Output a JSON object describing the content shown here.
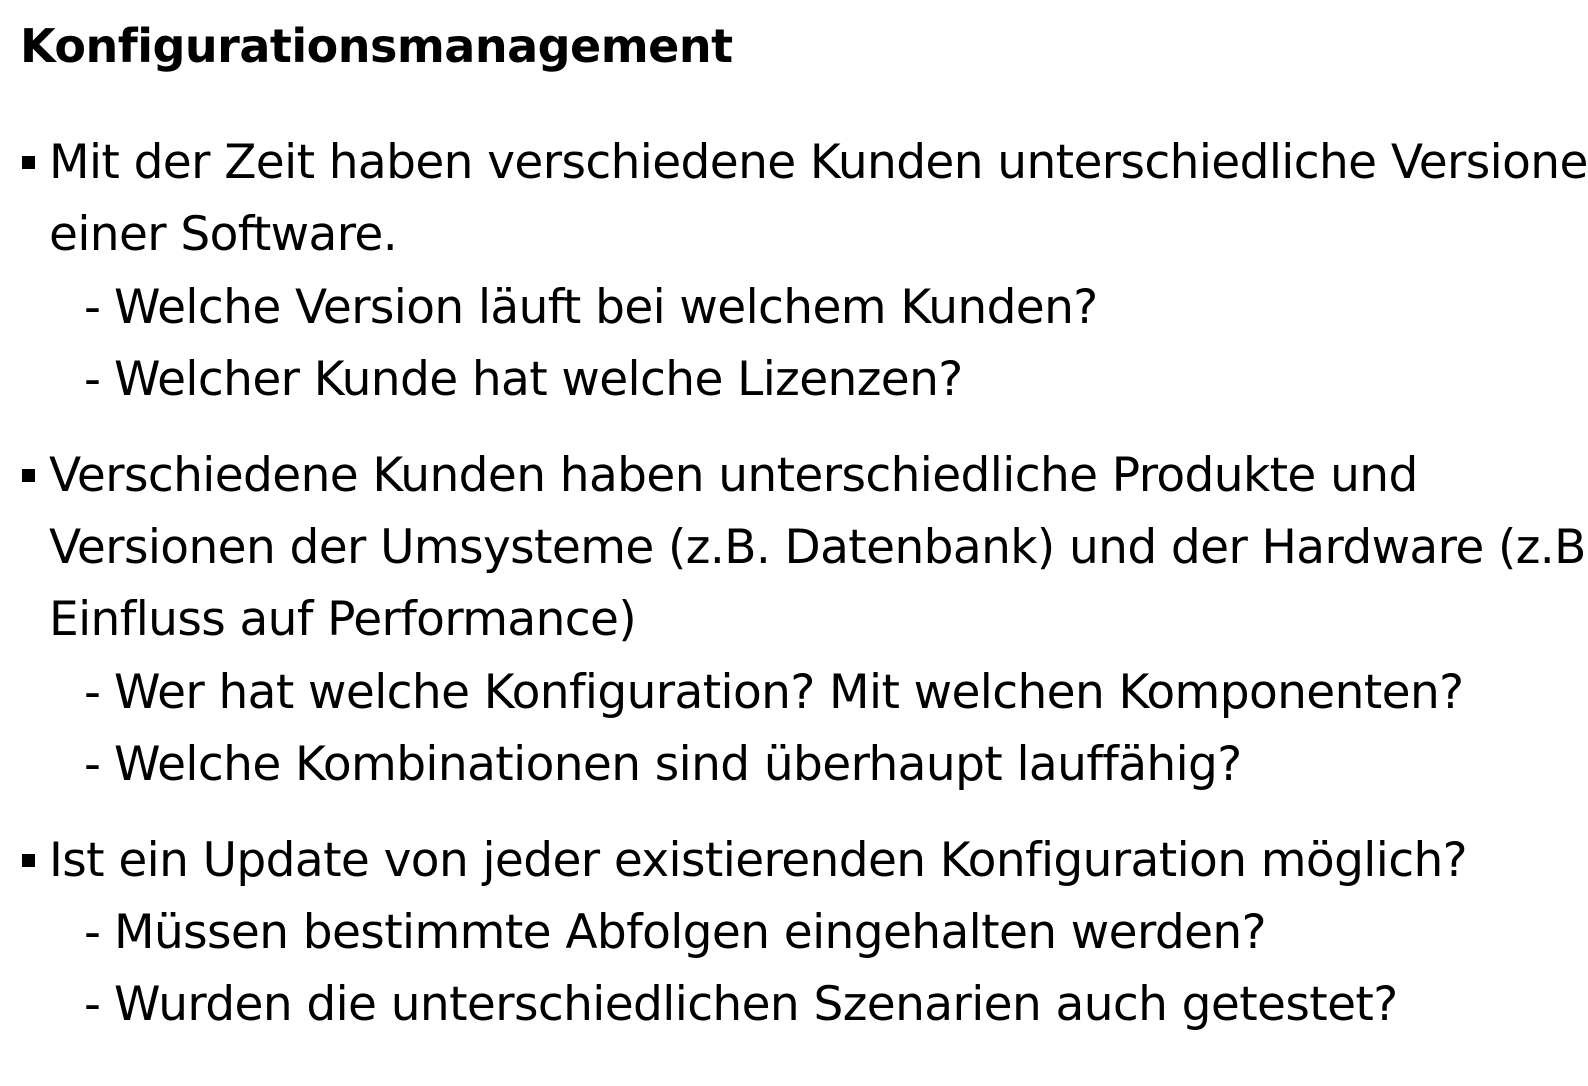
{
  "title": "Konfigurationsmanagement",
  "sections": [
    {
      "lines": [
        "Mit der Zeit haben verschiedene Kunden unterschiedliche Versionen",
        "einer Software."
      ],
      "subitems": [
        "Welche Version läuft bei welchem Kunden?",
        "Welcher Kunde hat welche Lizenzen?"
      ]
    },
    {
      "lines": [
        "Verschiedene Kunden haben unterschiedliche Produkte und",
        "Versionen der Umsysteme (z.B. Datenbank) und der Hardware (z.B.",
        "Einfluss auf Performance)"
      ],
      "subitems": [
        "Wer hat welche Konfiguration? Mit welchen Komponenten?",
        "Welche Kombinationen sind überhaupt lauffähig?"
      ]
    },
    {
      "lines": [
        "Ist ein Update von jeder existierenden Konfiguration möglich?"
      ],
      "subitems": [
        "Müssen bestimmte Abfolgen eingehalten werden?",
        "Wurden die unterschiedlichen Szenarien auch getestet?"
      ]
    }
  ],
  "subitem_marker": "-"
}
